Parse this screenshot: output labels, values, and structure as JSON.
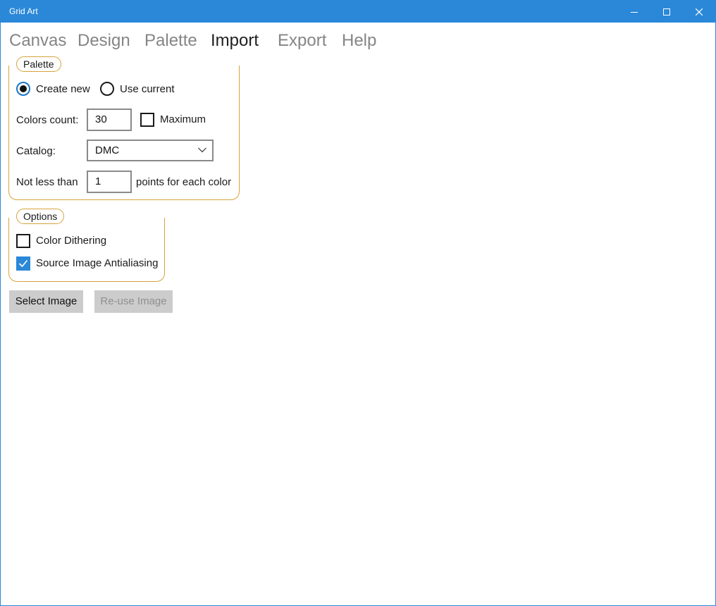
{
  "window": {
    "title": "Grid Art",
    "controls": {
      "minimize": "minimize-icon",
      "maximize": "maximize-icon",
      "close": "close-icon"
    }
  },
  "menu": {
    "items": [
      "Canvas",
      "Design",
      "Palette",
      "Import",
      "Export",
      "Help"
    ],
    "active": "Import"
  },
  "palette_group": {
    "header": "Palette",
    "create_new_label": "Create new",
    "create_new_selected": true,
    "use_current_label": "Use current",
    "use_current_selected": false,
    "colors_count_label": "Colors count:",
    "colors_count_value": "30",
    "maximum_label": "Maximum",
    "maximum_checked": false,
    "catalog_label": "Catalog:",
    "catalog_value": "DMC",
    "not_less_than_label": "Not less than",
    "not_less_than_value": "1",
    "points_suffix": "points for each color"
  },
  "options_group": {
    "header": "Options",
    "dithering_label": "Color Dithering",
    "dithering_checked": false,
    "antialiasing_label": "Source Image Antialiasing",
    "antialiasing_checked": true
  },
  "actions": {
    "select_image": "Select Image",
    "reuse_image": "Re-use Image",
    "reuse_enabled": false
  },
  "colors": {
    "titlebar": "#2b88d8",
    "group_border": "#d6a33c",
    "check_accent": "#2b88d8",
    "button_bg": "#cccccc"
  }
}
